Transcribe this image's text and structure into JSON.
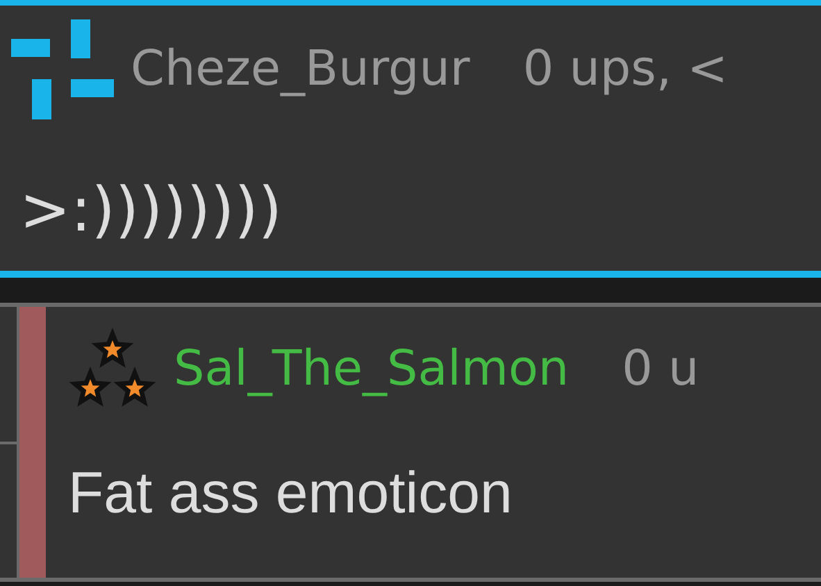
{
  "comments": [
    {
      "kind": "comment",
      "username": "Cheze_Burgur",
      "color": "#999999",
      "meta": "0 ups, <",
      "text": ">:))))))))"
    },
    {
      "kind": "reply",
      "username": "Sal_The_Salmon",
      "color": "#44bb44",
      "meta": "0 u",
      "text": "Fat ass emoticon"
    }
  ]
}
